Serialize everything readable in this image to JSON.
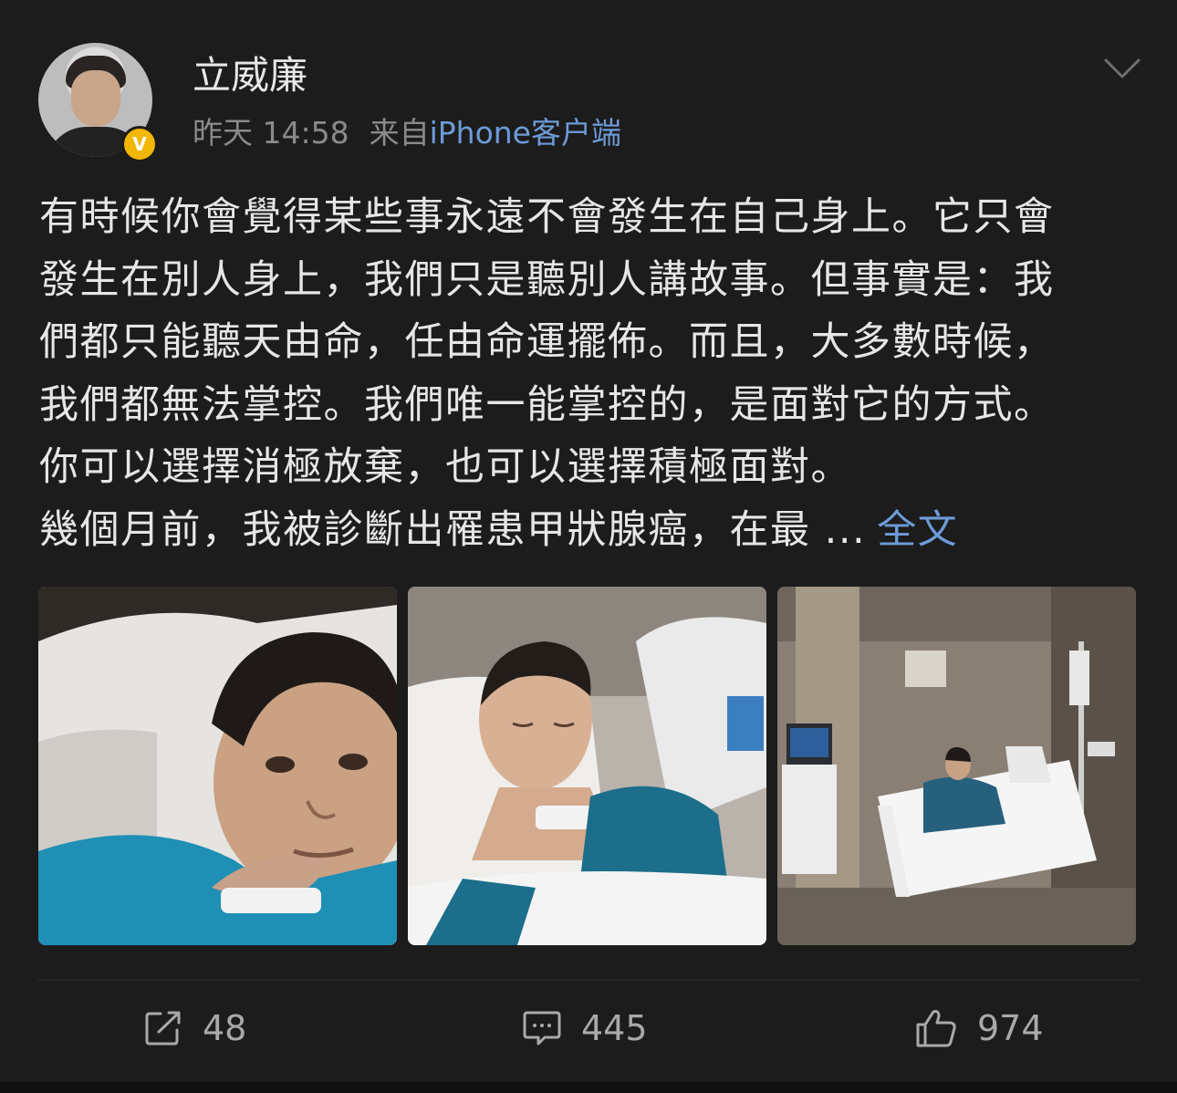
{
  "user": {
    "name": "立威廉",
    "verified_badge": "V",
    "timestamp": "昨天 14:58",
    "source_prefix": "来自",
    "source_client": "iPhone客户端"
  },
  "post": {
    "lines": [
      "有時候你會覺得某些事永遠不會發生在自己身上。它只會",
      "發生在別人身上，我們只是聽別人講故事。但事實是：我",
      "們都只能聽天由命，任由命運擺佈。而且，大多數時候，",
      "我們都無法掌控。我們唯一能掌控的，是面對它的方式。",
      "你可以選擇消極放棄，也可以選擇積極面對。",
      "幾個月前，我被診斷出罹患甲狀腺癌，在最 ..."
    ],
    "expand_label": "全文"
  },
  "images": [
    {
      "icon": "selfie-photo"
    },
    {
      "icon": "hospital-bed-photo"
    },
    {
      "icon": "hospital-room-photo"
    }
  ],
  "actions": {
    "repost_count": "48",
    "comment_count": "445",
    "like_count": "974"
  },
  "colors": {
    "background": "#1c1c1c",
    "link": "#6d9bd8",
    "badge": "#f2b705",
    "meta_text": "#8a8a8a"
  }
}
